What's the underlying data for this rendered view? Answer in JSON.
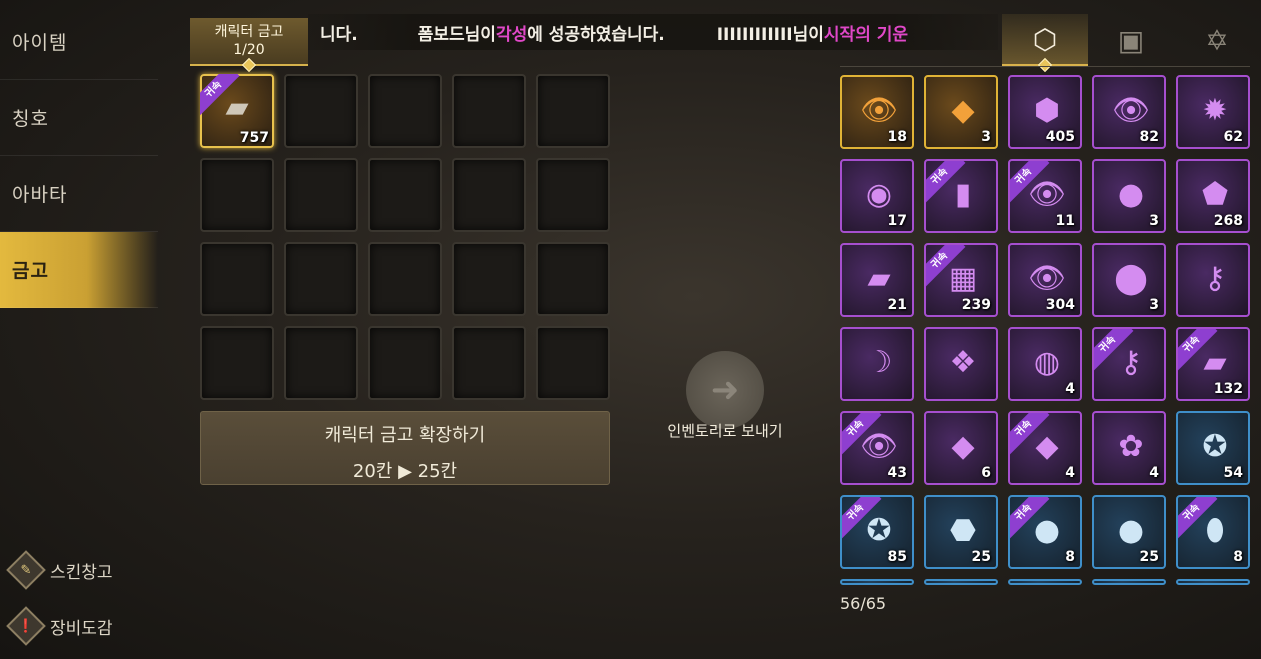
{
  "sidebar": {
    "items": [
      "아이템",
      "칭호",
      "아바타",
      "금고"
    ],
    "active": "금고",
    "bottom": [
      {
        "label": "스킨창고",
        "icon": "brush-icon"
      },
      {
        "label": "장비도감",
        "icon": "codex-icon"
      }
    ]
  },
  "banner": {
    "part0": "니다.",
    "part1": "폼보드님이 ",
    "part2": "각성",
    "part3": "에 성공하였습니다.",
    "part4": "IIIIIIIIIIII님이 ",
    "part5": "시작의 기운"
  },
  "vault": {
    "tab_title": "캐릭터 금고",
    "tab_count": "1/20",
    "item_count": "757",
    "expand_title": "캐릭터 금고 확장하기",
    "expand_detail": "20칸 ▶ 25칸"
  },
  "send": {
    "label": "인벤토리로 보내기",
    "icon": "arrow-right-icon"
  },
  "inventory": {
    "tabs": [
      "materials-icon",
      "cards-icon",
      "hexagram-icon"
    ],
    "bound_label": "귀속",
    "capacity": "56/65",
    "items": [
      {
        "icon": "eye-orb-icon",
        "glyph": "👁",
        "count": "18",
        "rarity": "gold",
        "bound": false
      },
      {
        "icon": "red-gem-icon",
        "glyph": "◆",
        "count": "3",
        "rarity": "gold",
        "bound": false
      },
      {
        "icon": "ore-icon",
        "glyph": "⬢",
        "count": "405",
        "rarity": "purple",
        "bound": false
      },
      {
        "icon": "eye-orb-icon",
        "glyph": "👁",
        "count": "82",
        "rarity": "purple",
        "bound": false
      },
      {
        "icon": "dark-orb-icon",
        "glyph": "✹",
        "count": "62",
        "rarity": "purple",
        "bound": false
      },
      {
        "icon": "coin-icon",
        "glyph": "◉",
        "count": "17",
        "rarity": "purple",
        "bound": false
      },
      {
        "icon": "potion-vial-icon",
        "glyph": "▮",
        "count": "",
        "rarity": "purple",
        "bound": true
      },
      {
        "icon": "eye-orb-icon",
        "glyph": "👁",
        "count": "11",
        "rarity": "purple",
        "bound": true
      },
      {
        "icon": "marble-icon",
        "glyph": "●",
        "count": "3",
        "rarity": "purple",
        "bound": false
      },
      {
        "icon": "stone-icon",
        "glyph": "⬟",
        "count": "268",
        "rarity": "purple",
        "bound": false
      },
      {
        "icon": "vault-chest-icon",
        "glyph": "▰",
        "count": "21",
        "rarity": "purple",
        "bound": false
      },
      {
        "icon": "gold-blocks-icon",
        "glyph": "▦",
        "count": "239",
        "rarity": "purple",
        "bound": true
      },
      {
        "icon": "eye-orb-icon",
        "glyph": "👁",
        "count": "304",
        "rarity": "purple",
        "bound": false
      },
      {
        "icon": "gold-nugget-icon",
        "glyph": "⬤",
        "count": "3",
        "rarity": "purple",
        "bound": false
      },
      {
        "icon": "key-icon",
        "glyph": "⚷",
        "count": "",
        "rarity": "purple",
        "bound": false
      },
      {
        "icon": "feather-icon",
        "glyph": "☽",
        "count": "",
        "rarity": "purple",
        "bound": false
      },
      {
        "icon": "crystal-icon",
        "glyph": "❖",
        "count": "",
        "rarity": "purple",
        "bound": false
      },
      {
        "icon": "cookie-icon",
        "glyph": "◍",
        "count": "4",
        "rarity": "purple",
        "bound": false
      },
      {
        "icon": "key-icon",
        "glyph": "⚷",
        "count": "",
        "rarity": "purple",
        "bound": true
      },
      {
        "icon": "vault-chest-icon",
        "glyph": "▰",
        "count": "132",
        "rarity": "purple",
        "bound": true
      },
      {
        "icon": "eye-orb-icon",
        "glyph": "👁",
        "count": "43",
        "rarity": "purple",
        "bound": true
      },
      {
        "icon": "crystal-shard-icon",
        "glyph": "◆",
        "count": "6",
        "rarity": "purple",
        "bound": false
      },
      {
        "icon": "crystal-shard-icon",
        "glyph": "◆",
        "count": "4",
        "rarity": "purple",
        "bound": true
      },
      {
        "icon": "food-plate-icon",
        "glyph": "✿",
        "count": "4",
        "rarity": "purple",
        "bound": false
      },
      {
        "icon": "emblem-icon",
        "glyph": "✪",
        "count": "54",
        "rarity": "blue",
        "bound": false
      },
      {
        "icon": "emblem-icon",
        "glyph": "✪",
        "count": "85",
        "rarity": "blue",
        "bound": true
      },
      {
        "icon": "rock-icon",
        "glyph": "⬣",
        "count": "25",
        "rarity": "blue",
        "bound": false
      },
      {
        "icon": "pearl-icon",
        "glyph": "●",
        "count": "8",
        "rarity": "blue",
        "bound": true
      },
      {
        "icon": "pearl-icon",
        "glyph": "●",
        "count": "25",
        "rarity": "blue",
        "bound": false
      },
      {
        "icon": "green-gem-icon",
        "glyph": "⬮",
        "count": "8",
        "rarity": "blue",
        "bound": true
      }
    ]
  },
  "colors": {
    "accent_gold": "#e3b93e",
    "highlight_pink": "#e048c8"
  }
}
